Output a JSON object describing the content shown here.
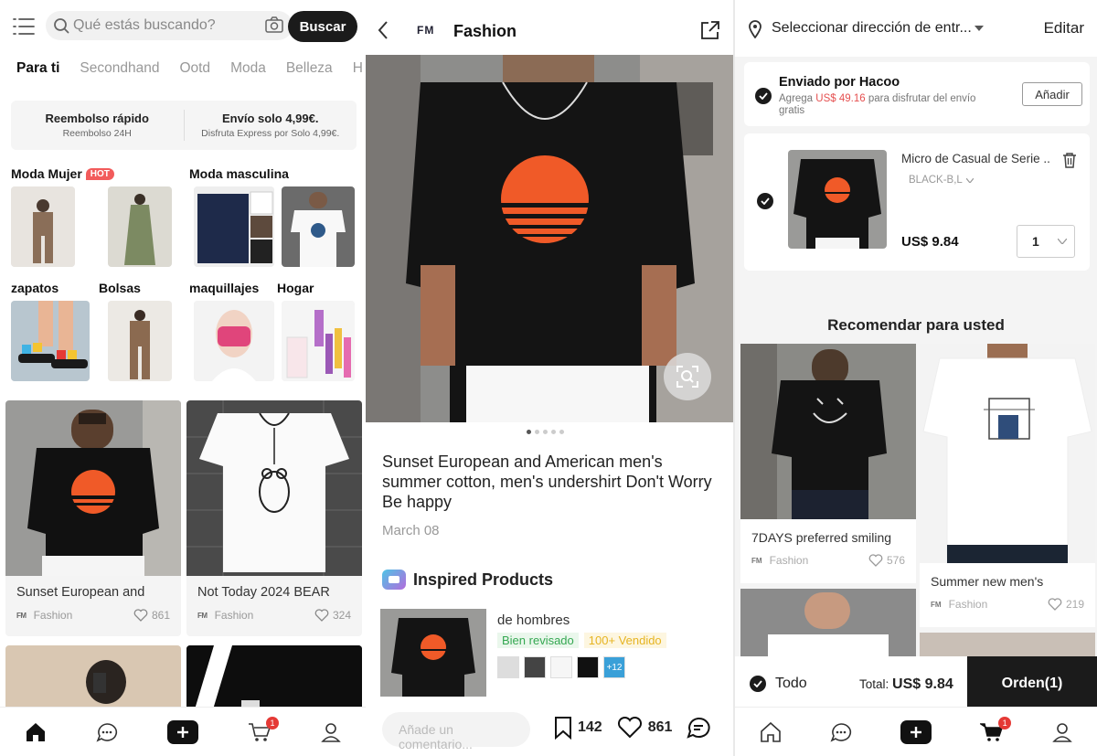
{
  "panel1": {
    "search": {
      "placeholder": "Qué estás buscando?",
      "button": "Buscar"
    },
    "tabs": [
      "Para ti",
      "Secondhand",
      "Ootd",
      "Moda",
      "Belleza",
      "H"
    ],
    "promo": [
      {
        "title": "Reembolso rápido",
        "subtitle": "Reembolso 24H"
      },
      {
        "title": "Envío solo 4,99€.",
        "subtitle": "Disfruta Express por Solo 4,99€."
      }
    ],
    "categories": {
      "moda_mujer": "Moda Mujer",
      "hot": "HOT",
      "moda_masculina": "Moda masculina",
      "zapatos": "zapatos",
      "bolsas": "Bolsas",
      "maquillajes": "maquillajes",
      "hogar": "Hogar"
    },
    "cards": [
      {
        "title": "Sunset European and",
        "author": "Fashion",
        "likes": "861"
      },
      {
        "title": "Not Today 2024 BEAR",
        "author": "Fashion",
        "likes": "324"
      }
    ],
    "nav_badge": "1"
  },
  "panel2": {
    "header": {
      "logo": "FM",
      "title": "Fashion"
    },
    "post_title": "Sunset European and American men's summer  cotton, men's undershirt Don't Worry Be happy",
    "date": "March 08",
    "inspired": "Inspired Products",
    "product": {
      "name": "de hombres",
      "tag1": "Bien revisado",
      "tag2": "100+ Vendido",
      "swatch_more": "+12"
    },
    "comment_placeholder": "Añade un comentario...",
    "saves": "142",
    "likes": "861"
  },
  "panel3": {
    "address": "Seleccionar dirección de entr...",
    "edit": "Editar",
    "shipping": {
      "title": "Enviado por Hacoo",
      "desc_pre": "Agrega ",
      "amount": "US$ 49.16",
      "desc_post": " para disfrutar del envío gratis",
      "add": "Añadir"
    },
    "item": {
      "name": "Micro de Casual de Serie ...",
      "variant": "BLACK-B,L",
      "price": "US$ 9.84",
      "qty": "1"
    },
    "recommend_title": "Recomendar para usted",
    "rec_cards": [
      {
        "title": "7DAYS preferred smiling",
        "author": "Fashion",
        "likes": "576"
      },
      {
        "title": "Summer new men's",
        "author": "Fashion",
        "likes": "219"
      }
    ],
    "checkout": {
      "all": "Todo",
      "total_label": "Total: ",
      "total": "US$ 9.84",
      "order": "Orden(1)"
    },
    "nav_badge": "1"
  },
  "colors": {
    "accent_dark": "#1b1b1b",
    "hot_red": "#f25b5b",
    "badge_red": "#e53935",
    "green_tag": "#35a852",
    "yellow_tag": "#e6b422"
  }
}
